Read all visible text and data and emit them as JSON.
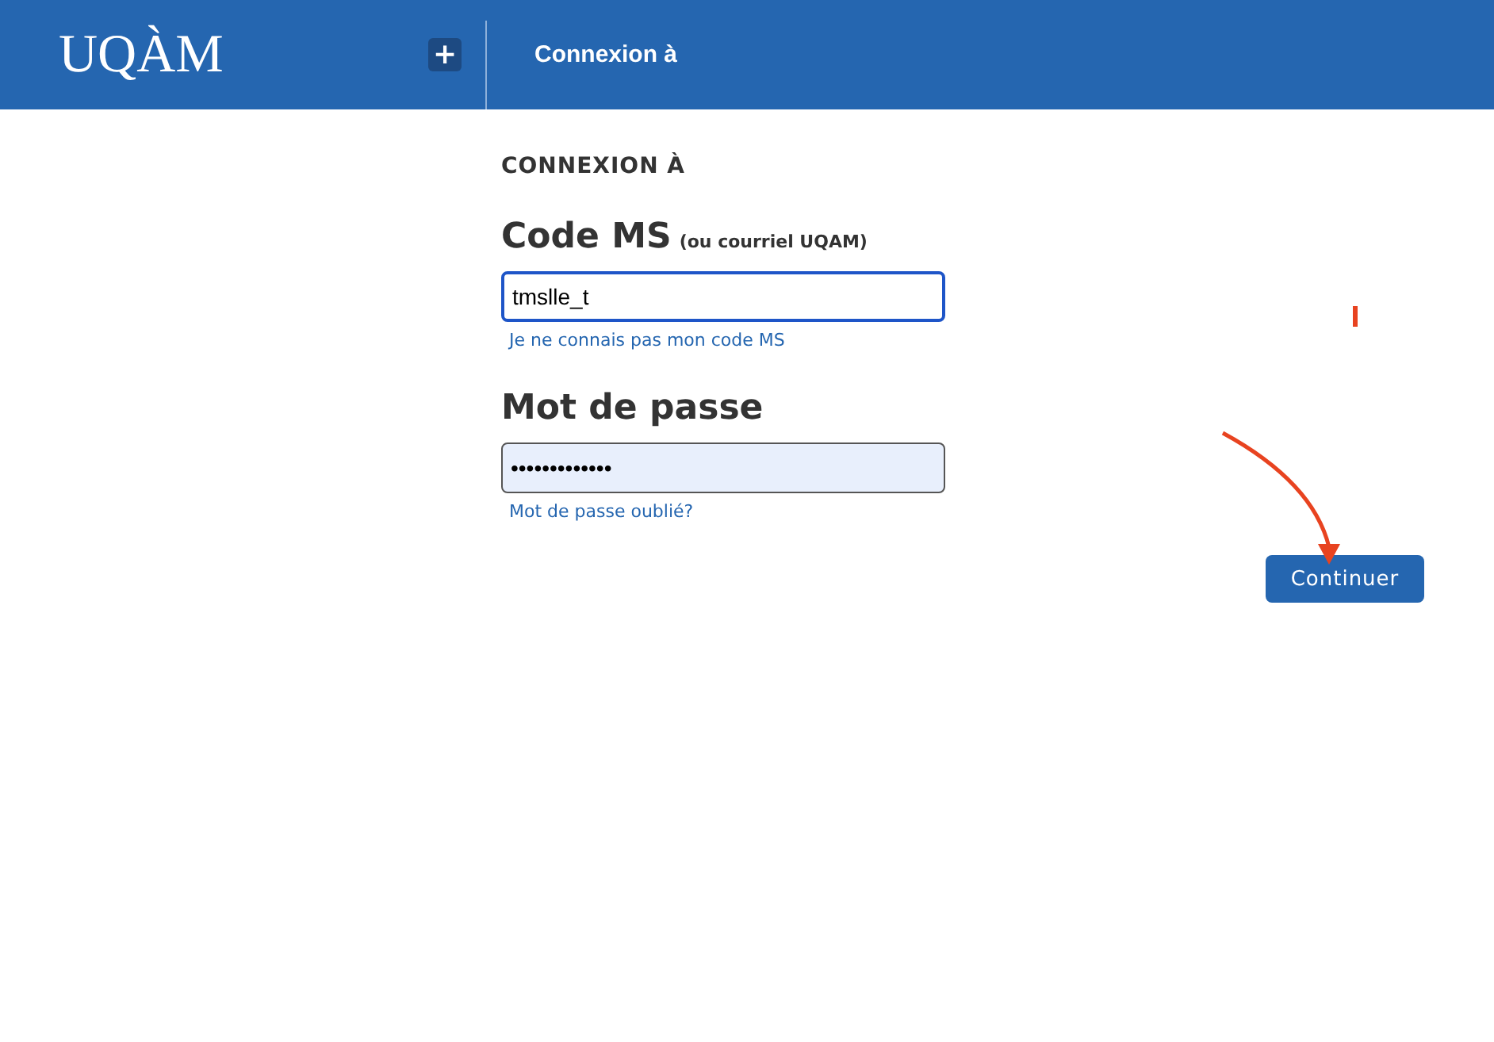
{
  "header": {
    "logo": "UQÀM",
    "menu_button": "+",
    "title": "Connexion à"
  },
  "form": {
    "heading": "CONNEXION À",
    "fields": [
      {
        "label": "Code MS",
        "note": "(ou courriel UQAM)",
        "value": "tmslle_t",
        "focused": true,
        "link": "Je ne connais pas mon code MS"
      },
      {
        "label": "Mot de passe",
        "value": "•••••••••••••",
        "focused": false,
        "link": "Mot de passe oublié?"
      }
    ]
  },
  "submit_button": "Continuer"
}
